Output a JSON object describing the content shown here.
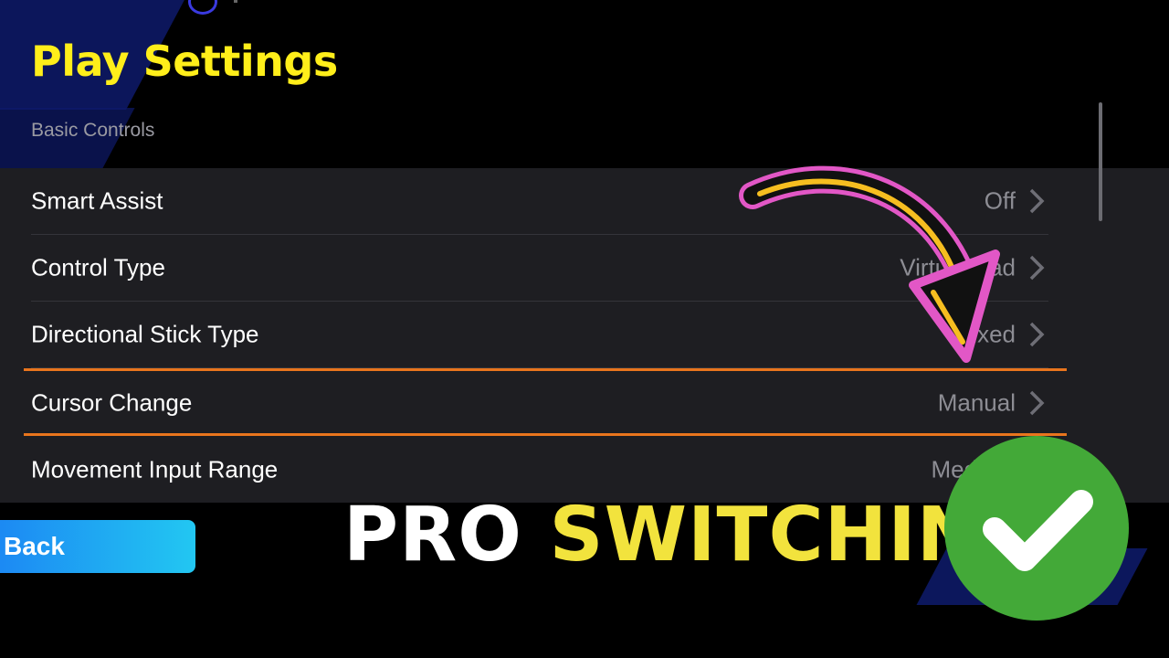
{
  "header": {
    "title": "Play Settings",
    "section": "Basic Controls"
  },
  "settings": [
    {
      "label": "Smart Assist",
      "value": "Off"
    },
    {
      "label": "Control Type",
      "value": "Virtual Pad"
    },
    {
      "label": "Directional Stick Type",
      "value": "Fixed"
    },
    {
      "label": "Cursor Change",
      "value": "Manual"
    },
    {
      "label": "Movement Input Range",
      "value": "Medium"
    }
  ],
  "footer": {
    "back_label": "Back"
  },
  "overlay": {
    "word1": "PRO",
    "word2": "SWITCHING"
  },
  "icons": {
    "row_chevron": "chevron-right-icon",
    "badge": "checkmark-icon",
    "annotation": "curved-arrow-icon"
  },
  "colors": {
    "title": "#ffee1a",
    "highlight": "#e9751d",
    "back_button": "#1c86f3",
    "badge": "#43a938",
    "arrow_outline": "#e257c6",
    "arrow_accent": "#f6be20"
  }
}
